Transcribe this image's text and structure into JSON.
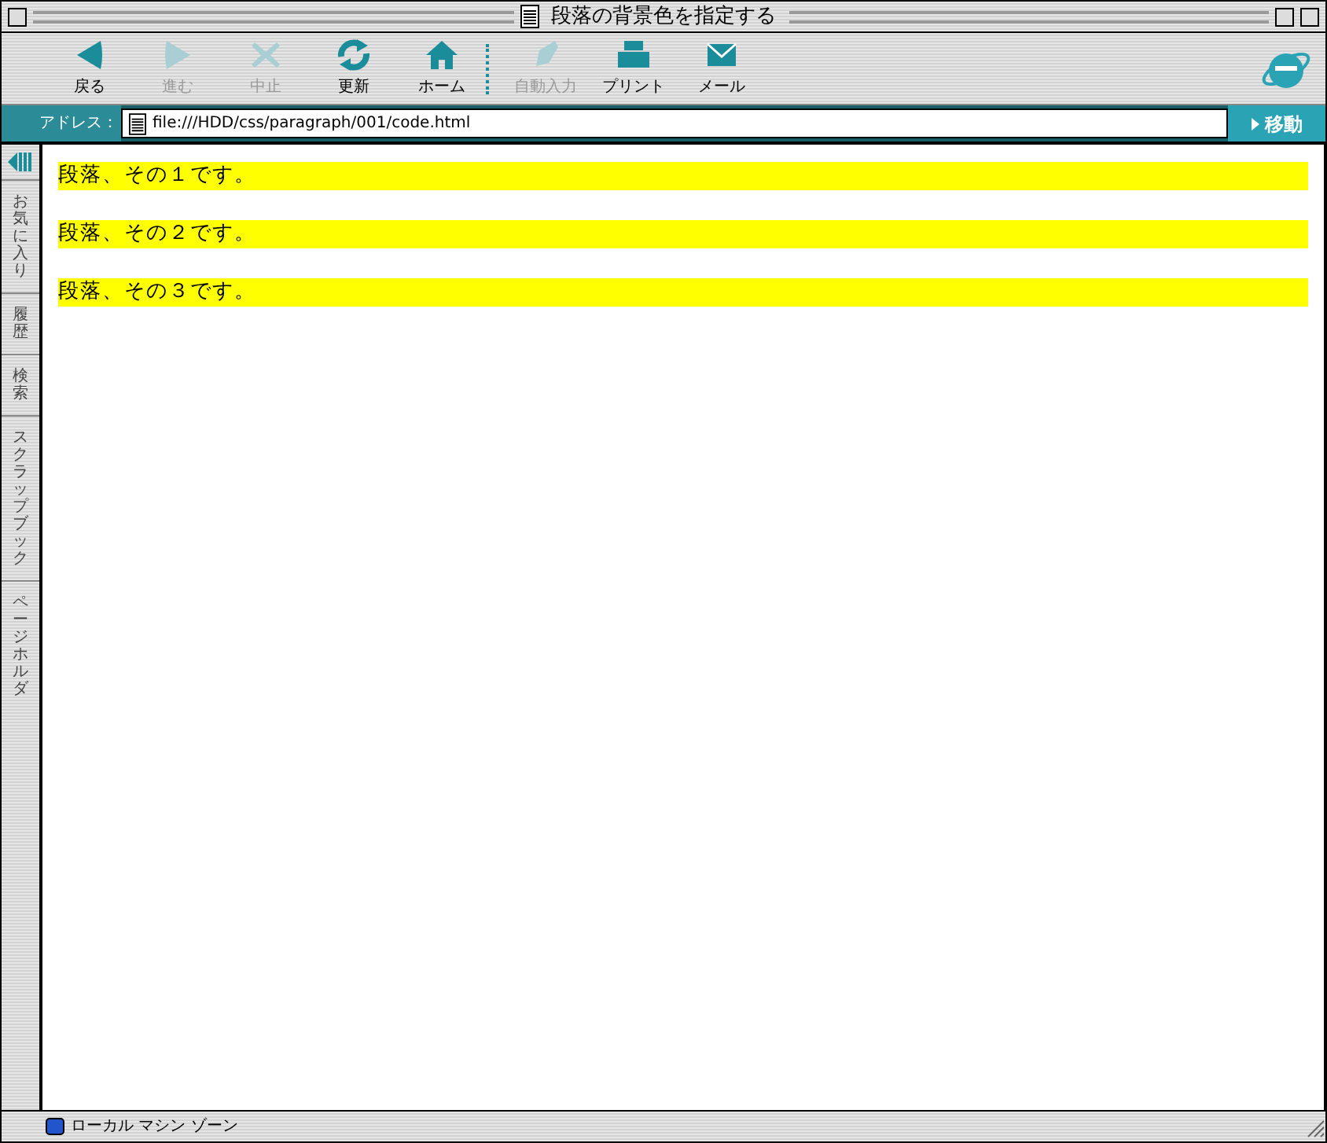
{
  "window": {
    "title": "段落の背景色を指定する"
  },
  "toolbar": [
    {
      "label": "戻る",
      "kind": "back",
      "disabled": false
    },
    {
      "label": "進む",
      "kind": "forward",
      "disabled": true
    },
    {
      "label": "中止",
      "kind": "stop",
      "disabled": true
    },
    {
      "label": "更新",
      "kind": "refresh",
      "disabled": false
    },
    {
      "label": "ホーム",
      "kind": "home",
      "disabled": false
    },
    {
      "label": "自動入力",
      "kind": "autofill",
      "disabled": true
    },
    {
      "label": "プリント",
      "kind": "print",
      "disabled": false
    },
    {
      "label": "メール",
      "kind": "mail",
      "disabled": false
    }
  ],
  "address_bar": {
    "label": "アドレス：",
    "value": "file:///HDD/css/paragraph/001/code.html",
    "go_button": "移動"
  },
  "sidebar_tabs": [
    "お気に入り",
    "履歴",
    "検索",
    "スクラップブック",
    "ページホルダ"
  ],
  "paragraphs": [
    {
      "text": "段落、その１です。"
    },
    {
      "text": "段落、その２です。"
    },
    {
      "text": "段落、その３です。"
    }
  ],
  "status_bar": {
    "zone": "ローカル マシン ゾーン"
  }
}
